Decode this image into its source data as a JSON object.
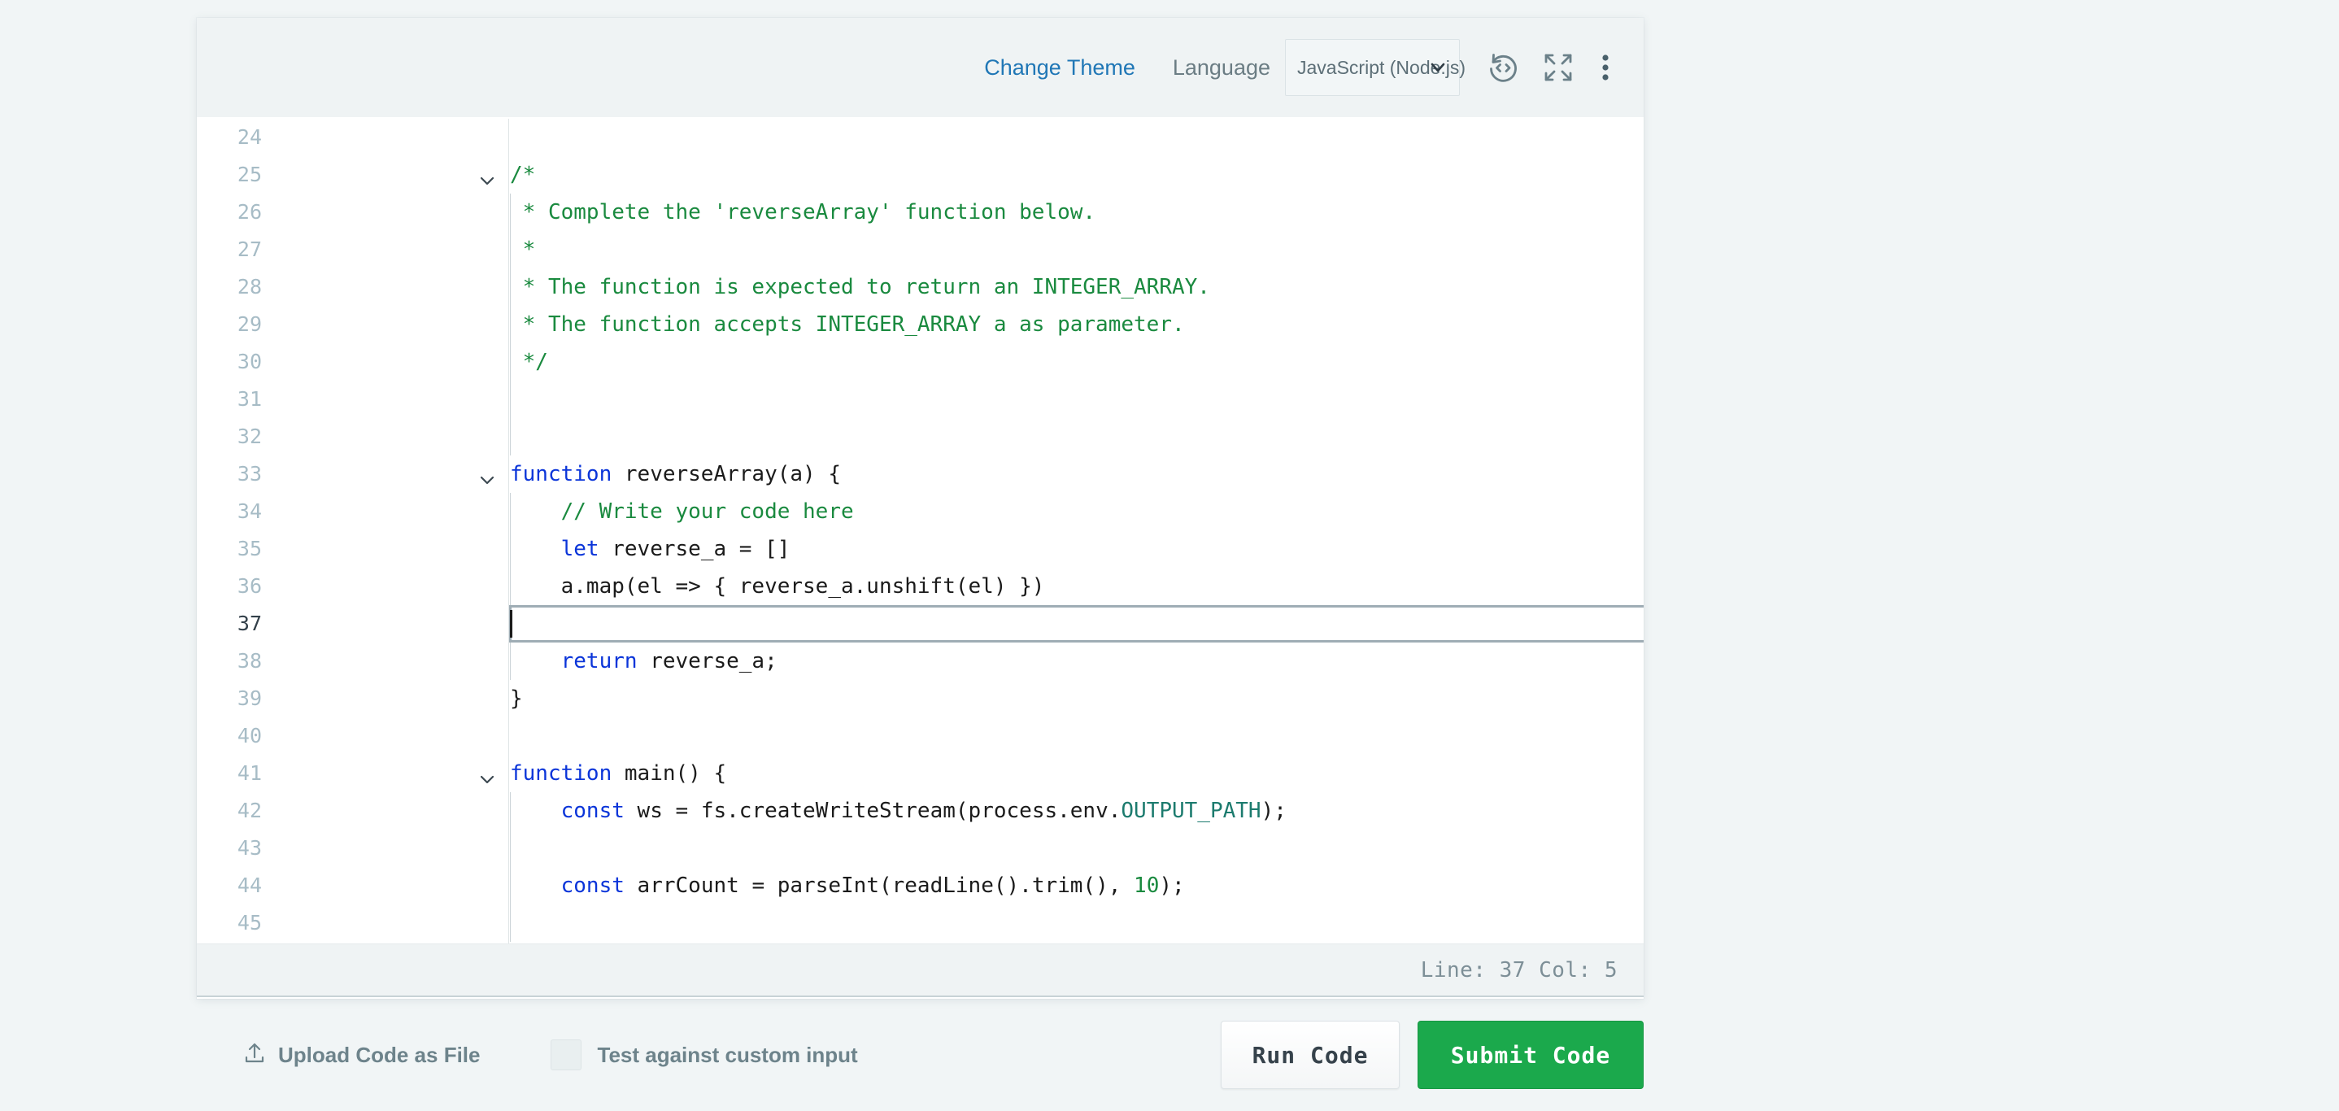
{
  "header": {
    "change_theme_label": "Change Theme",
    "language_label": "Language",
    "language_value": "JavaScript (Node.js)",
    "icons": {
      "reset": "reset-code-icon",
      "fullscreen": "fullscreen-icon",
      "more": "more-options-icon"
    }
  },
  "editor": {
    "lines": [
      {
        "num": "24",
        "fold": false,
        "guide": false,
        "segments": []
      },
      {
        "num": "25",
        "fold": true,
        "guide": false,
        "segments": [
          {
            "t": "/*",
            "c": "cmt"
          }
        ]
      },
      {
        "num": "26",
        "fold": false,
        "guide": true,
        "segments": [
          {
            "t": " * Complete the 'reverseArray' function below.",
            "c": "cmt"
          }
        ]
      },
      {
        "num": "27",
        "fold": false,
        "guide": true,
        "segments": [
          {
            "t": " *",
            "c": "cmt"
          }
        ]
      },
      {
        "num": "28",
        "fold": false,
        "guide": true,
        "segments": [
          {
            "t": " * The function is expected to return an INTEGER_ARRAY.",
            "c": "cmt"
          }
        ]
      },
      {
        "num": "29",
        "fold": false,
        "guide": true,
        "segments": [
          {
            "t": " * The function accepts INTEGER_ARRAY a as parameter.",
            "c": "cmt"
          }
        ]
      },
      {
        "num": "30",
        "fold": false,
        "guide": true,
        "segments": [
          {
            "t": " */",
            "c": "cmt"
          }
        ]
      },
      {
        "num": "31",
        "fold": false,
        "guide": true,
        "segments": []
      },
      {
        "num": "32",
        "fold": false,
        "guide": true,
        "segments": []
      },
      {
        "num": "33",
        "fold": true,
        "guide": false,
        "segments": [
          {
            "t": "function",
            "c": "kw"
          },
          {
            "t": " reverseArray(a) {",
            "c": ""
          }
        ]
      },
      {
        "num": "34",
        "fold": false,
        "guide": true,
        "segments": [
          {
            "t": "    // Write your code here",
            "c": "cmt"
          }
        ]
      },
      {
        "num": "35",
        "fold": false,
        "guide": true,
        "segments": [
          {
            "t": "    ",
            "c": ""
          },
          {
            "t": "let",
            "c": "kw"
          },
          {
            "t": " reverse_a = []",
            "c": ""
          }
        ]
      },
      {
        "num": "36",
        "fold": false,
        "guide": true,
        "segments": [
          {
            "t": "    a.map(el => { reverse_a.unshift(el) })",
            "c": ""
          }
        ]
      },
      {
        "num": "37",
        "fold": false,
        "guide": true,
        "active": true,
        "segments": []
      },
      {
        "num": "38",
        "fold": false,
        "guide": true,
        "segments": [
          {
            "t": "    ",
            "c": ""
          },
          {
            "t": "return",
            "c": "kw"
          },
          {
            "t": " reverse_a;",
            "c": ""
          }
        ]
      },
      {
        "num": "39",
        "fold": false,
        "guide": false,
        "segments": [
          {
            "t": "}",
            "c": ""
          }
        ]
      },
      {
        "num": "40",
        "fold": false,
        "guide": false,
        "segments": []
      },
      {
        "num": "41",
        "fold": true,
        "guide": false,
        "segments": [
          {
            "t": "function",
            "c": "kw"
          },
          {
            "t": " main() {",
            "c": ""
          }
        ]
      },
      {
        "num": "42",
        "fold": false,
        "guide": true,
        "segments": [
          {
            "t": "    ",
            "c": ""
          },
          {
            "t": "const",
            "c": "kw"
          },
          {
            "t": " ws = fs.createWriteStream(process.env.",
            "c": ""
          },
          {
            "t": "OUTPUT_PATH",
            "c": "cst"
          },
          {
            "t": ");",
            "c": ""
          }
        ]
      },
      {
        "num": "43",
        "fold": false,
        "guide": true,
        "segments": []
      },
      {
        "num": "44",
        "fold": false,
        "guide": true,
        "segments": [
          {
            "t": "    ",
            "c": ""
          },
          {
            "t": "const",
            "c": "kw"
          },
          {
            "t": " arrCount = parseInt(readLine().trim(), ",
            "c": ""
          },
          {
            "t": "10",
            "c": "num"
          },
          {
            "t": ");",
            "c": ""
          }
        ]
      },
      {
        "num": "45",
        "fold": false,
        "guide": true,
        "segments": []
      }
    ]
  },
  "status": {
    "text": "Line: 37 Col: 5",
    "line": "37",
    "col": "5"
  },
  "actions": {
    "upload_label": "Upload Code as File",
    "custom_input_label": "Test against custom input",
    "custom_input_checked": false,
    "run_label": "Run Code",
    "submit_label": "Submit Code"
  },
  "colors": {
    "page_bg": "#f1f5f6",
    "panel_bg": "#eff3f4",
    "link": "#2077b6",
    "submit_green": "#1ba94c",
    "comment_green": "#1a8a3f",
    "keyword_blue": "#0b35d9",
    "gutter_number": "#a7bcc6"
  }
}
